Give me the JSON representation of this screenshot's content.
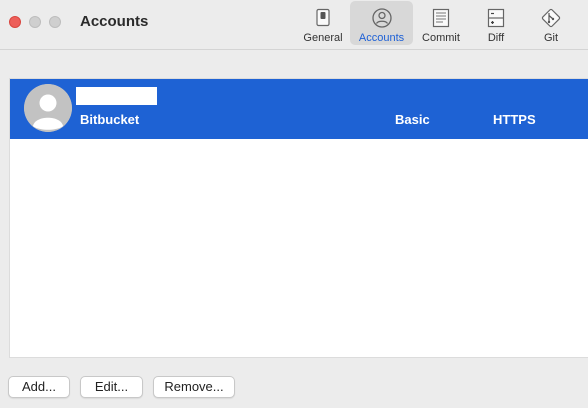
{
  "window": {
    "title": "Accounts"
  },
  "toolbar": {
    "items": [
      {
        "label": "General",
        "icon": "general-switch-icon",
        "active": false
      },
      {
        "label": "Accounts",
        "icon": "account-person-icon",
        "active": true
      },
      {
        "label": "Commit",
        "icon": "commit-document-icon",
        "active": false
      },
      {
        "label": "Diff",
        "icon": "diff-icon",
        "active": false
      },
      {
        "label": "Git",
        "icon": "git-icon",
        "active": false
      }
    ]
  },
  "accounts": [
    {
      "host": "Bitbucket",
      "auth": "Basic",
      "protocol": "HTTPS",
      "selected": true,
      "avatar_icon": "person-silhouette-icon"
    }
  ],
  "buttons": {
    "add": "Add...",
    "edit": "Edit...",
    "remove": "Remove..."
  },
  "colors": {
    "selection": "#1e62d4",
    "active_tab_label": "#1d60d6",
    "close_button": "#ed5f5a"
  }
}
